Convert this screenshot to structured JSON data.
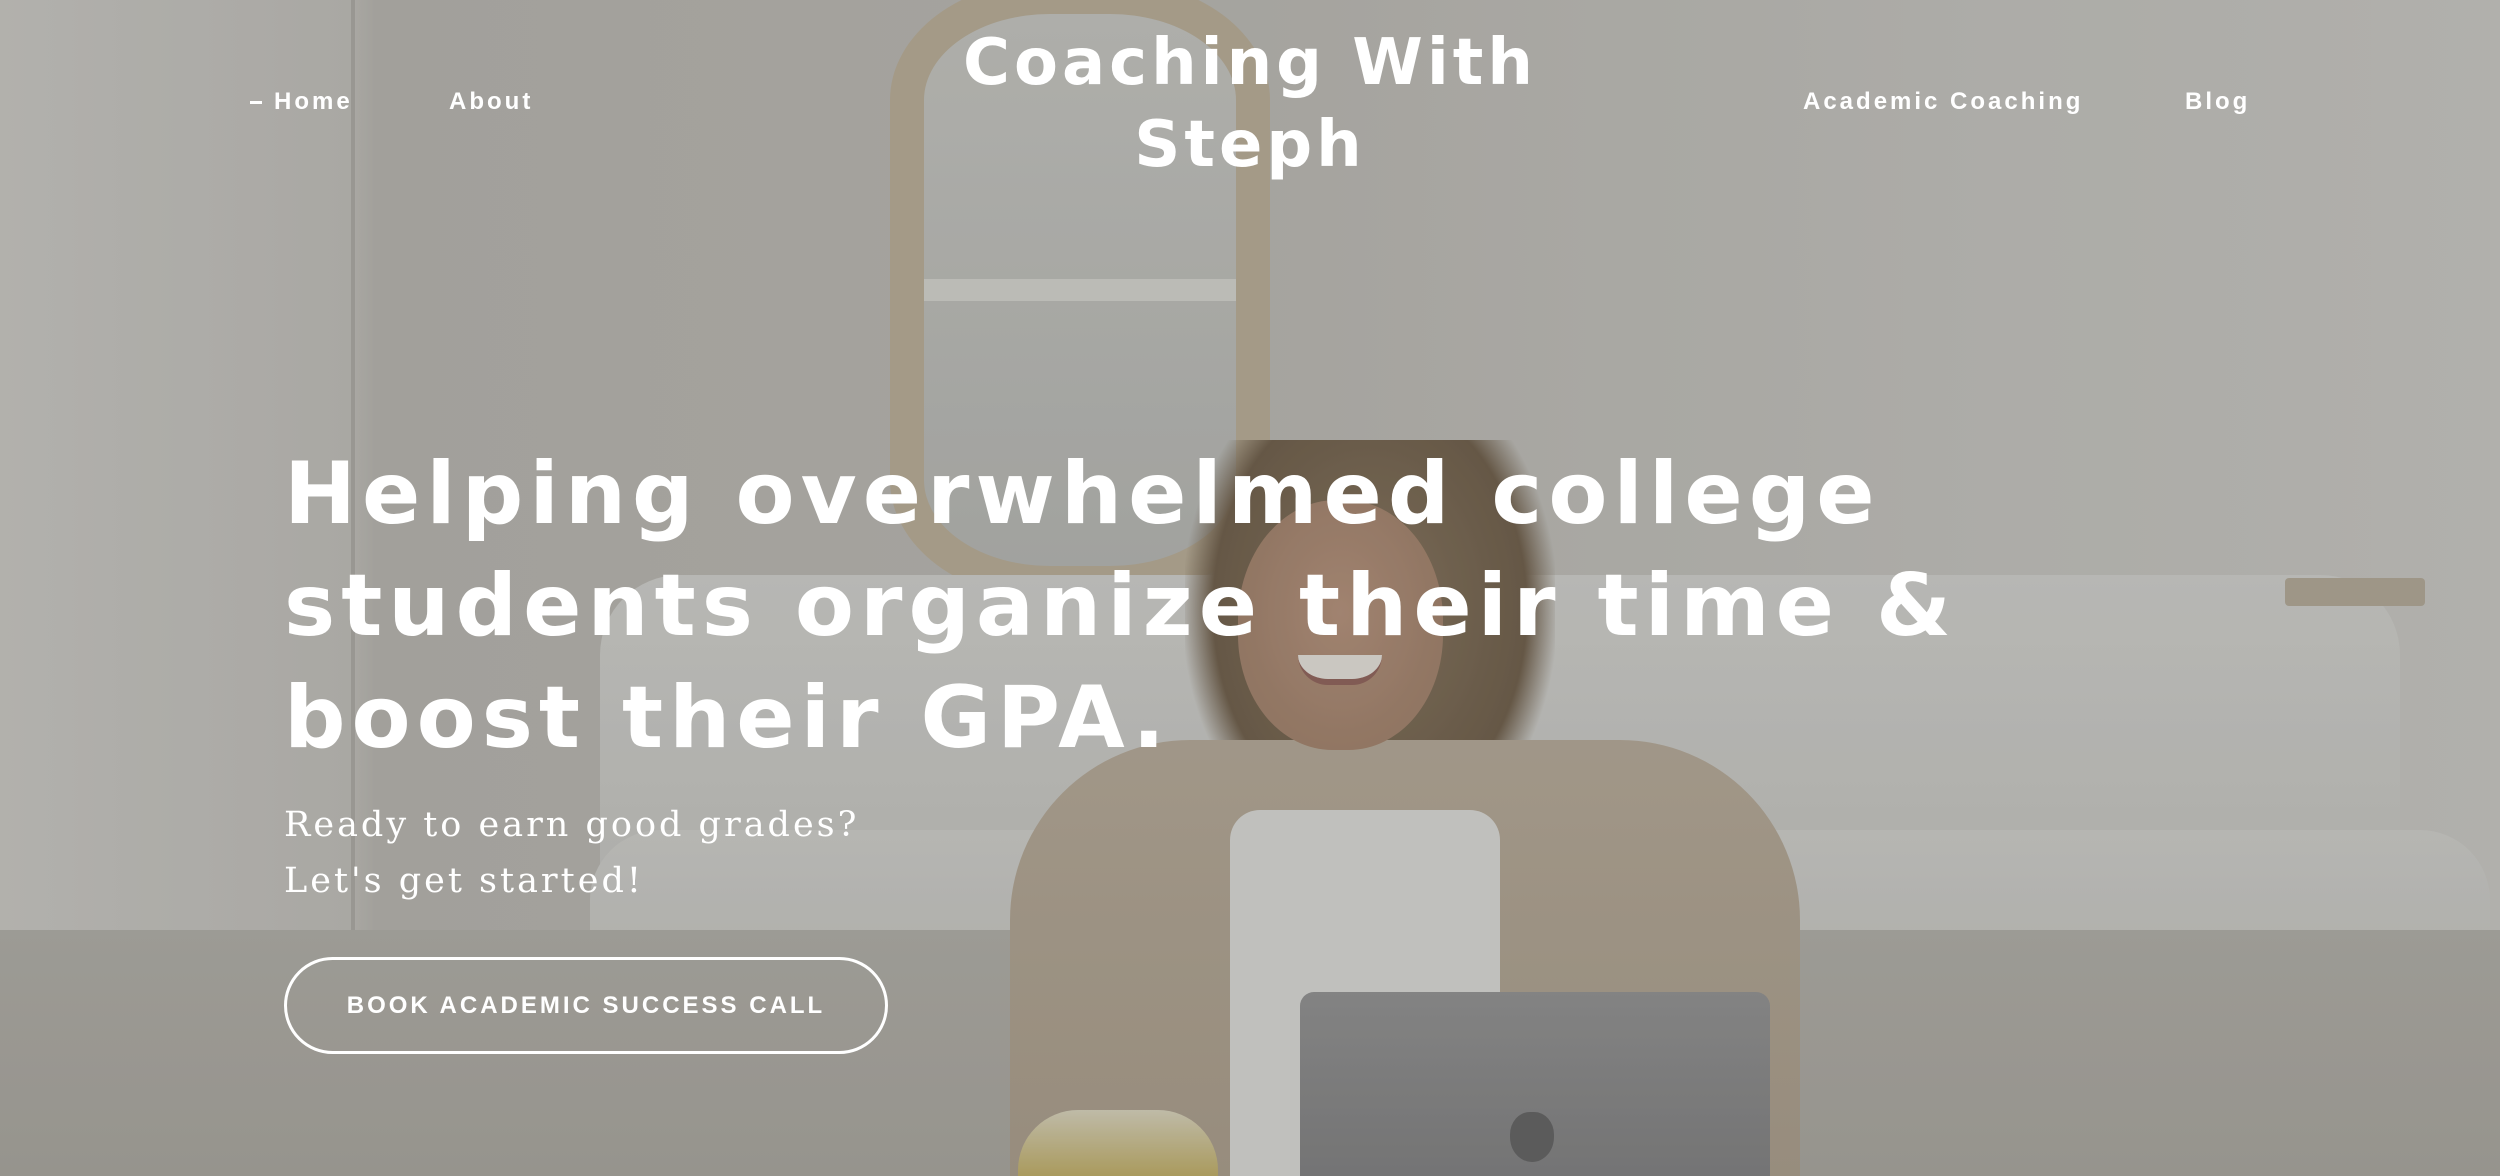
{
  "header": {
    "site_title": "Coaching With Steph",
    "nav": {
      "home": "Home",
      "about": "About",
      "academic_coaching": "Academic Coaching",
      "blog": "Blog"
    },
    "active_nav": "home"
  },
  "hero": {
    "headline": "Helping overwhelmed college students organize their time & boost their GPA.",
    "subline_1": "Ready to earn good grades?",
    "subline_2": "Let's get started!",
    "cta_label": "BOOK ACADEMIC SUCCESS CALL",
    "background_image": "smiling woman seated in front of a white sofa with a laptop, wavy mirror on wall"
  },
  "colors": {
    "text": "#ffffff",
    "overlay": "#504e4a"
  }
}
